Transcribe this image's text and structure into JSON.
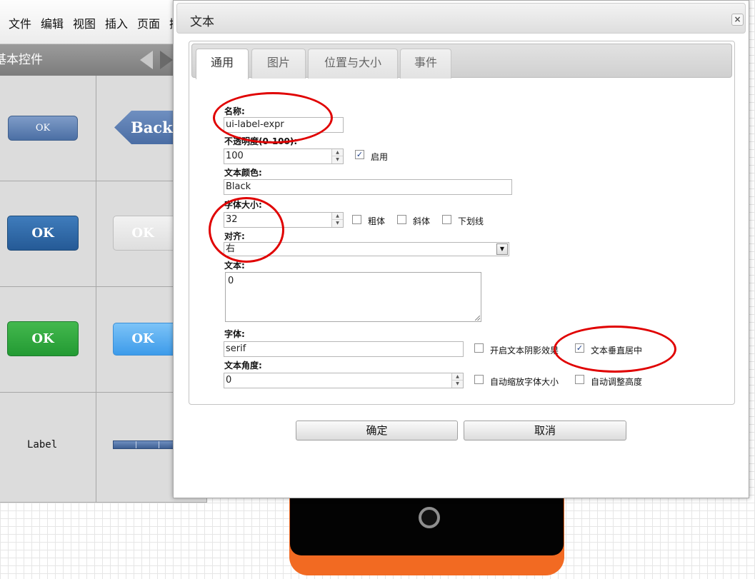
{
  "menu": {
    "items": [
      "文件",
      "编辑",
      "视图",
      "插入",
      "页面",
      "插"
    ]
  },
  "panel": {
    "title": "基本控件",
    "controls": {
      "ok1": "OK",
      "back": "Back",
      "ok2": "OK",
      "ok_disabled": "OK",
      "ok3": "OK",
      "ok4": "OK",
      "label": "Label"
    }
  },
  "dialog": {
    "title": "文本",
    "close_icon": "×",
    "tabs": [
      "通用",
      "图片",
      "位置与大小",
      "事件"
    ],
    "active_tab": "通用",
    "fields": {
      "name_label": "名称:",
      "name_value": "ui-label-expr",
      "opacity_label": "不透明度(0-100):",
      "opacity_value": "100",
      "enable_label": "启用",
      "enable_checked": true,
      "color_label": "文本颜色:",
      "color_value": "Black",
      "font_size_label": "字体大小:",
      "font_size_value": "32",
      "bold_label": "粗体",
      "italic_label": "斜体",
      "underline_label": "下划线",
      "align_label": "对齐:",
      "align_value": "右",
      "text_label": "文本:",
      "text_value": "0",
      "font_label": "字体:",
      "font_value": "serif",
      "shadow_label": "开启文本阴影效果",
      "vcenter_label": "文本垂直居中",
      "vcenter_checked": true,
      "angle_label": "文本角度:",
      "angle_value": "0",
      "autoscale_label": "自动缩放字体大小",
      "autoheight_label": "自动调整高度"
    },
    "buttons": {
      "ok": "确定",
      "cancel": "取消"
    }
  },
  "colors": {
    "annotation": "#e00000",
    "phone_body": "#f26a22"
  }
}
